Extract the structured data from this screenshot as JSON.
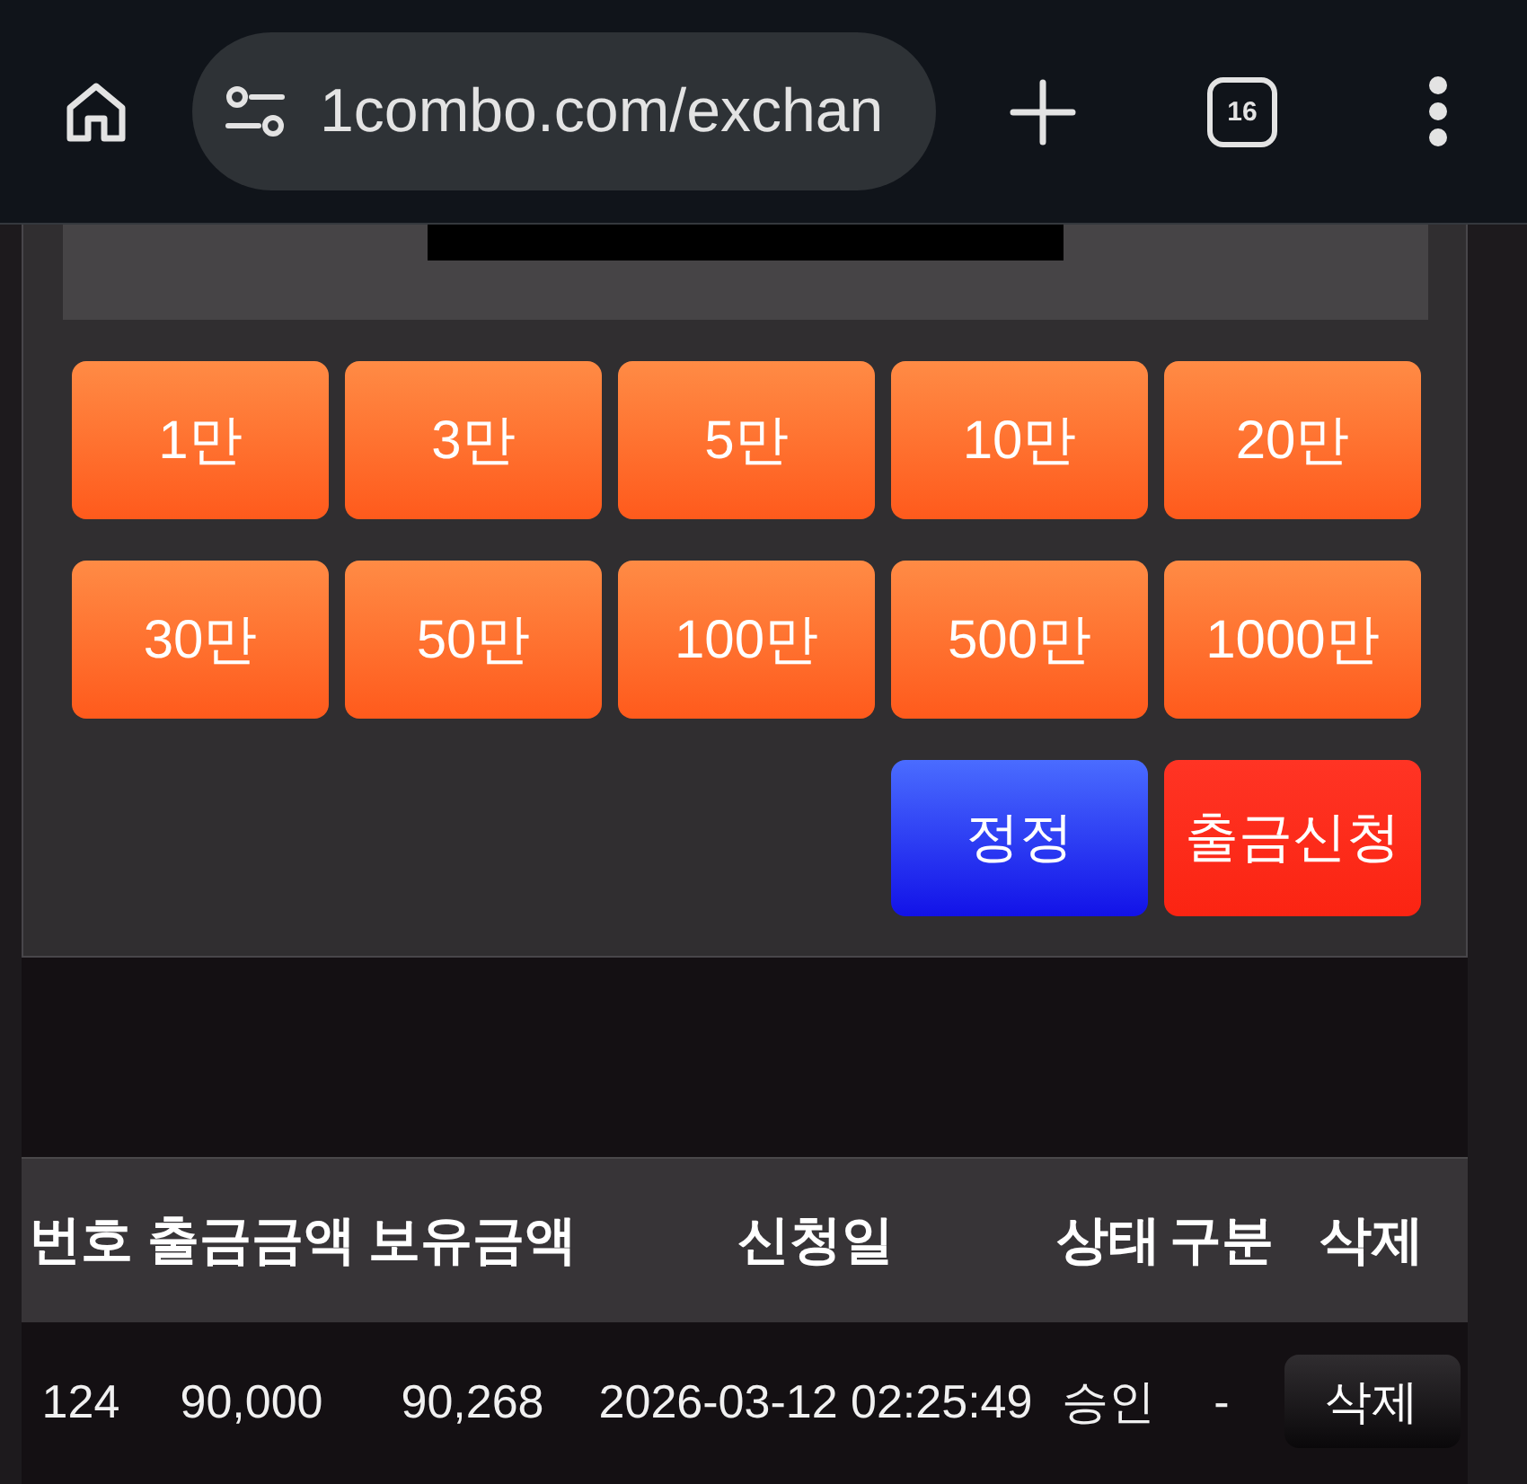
{
  "browser_toolbar": {
    "address": "1combo.com/exchan",
    "tab_count": "16"
  },
  "amount_buttons": [
    "1만",
    "3만",
    "5만",
    "10만",
    "20만",
    "30만",
    "50만",
    "100만",
    "500만",
    "1000만"
  ],
  "action_buttons": [
    {
      "label": "정정",
      "kind": "reset"
    },
    {
      "label": "출금신청",
      "kind": "submit"
    }
  ],
  "withdrawals_table": {
    "columns": [
      "번호",
      "출금금액",
      "보유금액",
      "신청일",
      "상태",
      "구분",
      "삭제"
    ],
    "rows": [
      {
        "cells": [
          "124",
          "90,000",
          "90,268",
          "2026-03-12 02:25:49",
          "승인",
          "-"
        ],
        "delete_button": "삭제"
      }
    ]
  }
}
